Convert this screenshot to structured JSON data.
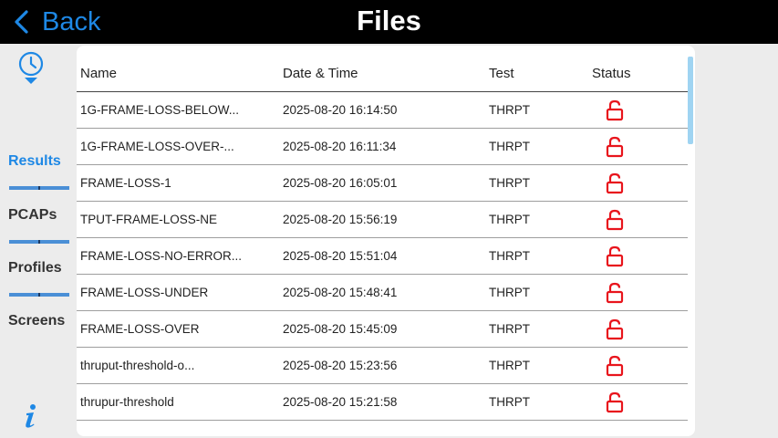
{
  "header": {
    "back_label": "Back",
    "title": "Files"
  },
  "sidebar": {
    "items": [
      {
        "label": "Results",
        "active": true
      },
      {
        "label": "PCAPs",
        "active": false
      },
      {
        "label": "Profiles",
        "active": false
      },
      {
        "label": "Screens",
        "active": false
      }
    ]
  },
  "table": {
    "columns": [
      "Name",
      "Date & Time",
      "Test",
      "Status"
    ],
    "rows": [
      {
        "name": "1G-FRAME-LOSS-BELOW...",
        "datetime": "2025-08-20 16:14:50",
        "test": "THRPT",
        "status": "unlocked"
      },
      {
        "name": "1G-FRAME-LOSS-OVER-...",
        "datetime": "2025-08-20 16:11:34",
        "test": "THRPT",
        "status": "unlocked"
      },
      {
        "name": "FRAME-LOSS-1",
        "datetime": "2025-08-20 16:05:01",
        "test": "THRPT",
        "status": "unlocked"
      },
      {
        "name": "TPUT-FRAME-LOSS-NE",
        "datetime": "2025-08-20 15:56:19",
        "test": "THRPT",
        "status": "unlocked"
      },
      {
        "name": "FRAME-LOSS-NO-ERROR...",
        "datetime": "2025-08-20 15:51:04",
        "test": "THRPT",
        "status": "unlocked"
      },
      {
        "name": "FRAME-LOSS-UNDER",
        "datetime": "2025-08-20 15:48:41",
        "test": "THRPT",
        "status": "unlocked"
      },
      {
        "name": "FRAME-LOSS-OVER",
        "datetime": "2025-08-20 15:45:09",
        "test": "THRPT",
        "status": "unlocked"
      },
      {
        "name": "thruput-threshold-o...",
        "datetime": "2025-08-20 15:23:56",
        "test": "THRPT",
        "status": "unlocked"
      },
      {
        "name": "thrupur-threshold",
        "datetime": "2025-08-20 15:21:58",
        "test": "THRPT",
        "status": "unlocked"
      }
    ]
  },
  "colors": {
    "accent": "#1e88e5",
    "topbar": "#000000",
    "lock_icon": "#e8141c",
    "background": "#ececec"
  },
  "icons": {
    "back": "chevron-left-icon",
    "history": "clock-history-icon",
    "info": "info-icon",
    "status": "unlock-icon"
  }
}
